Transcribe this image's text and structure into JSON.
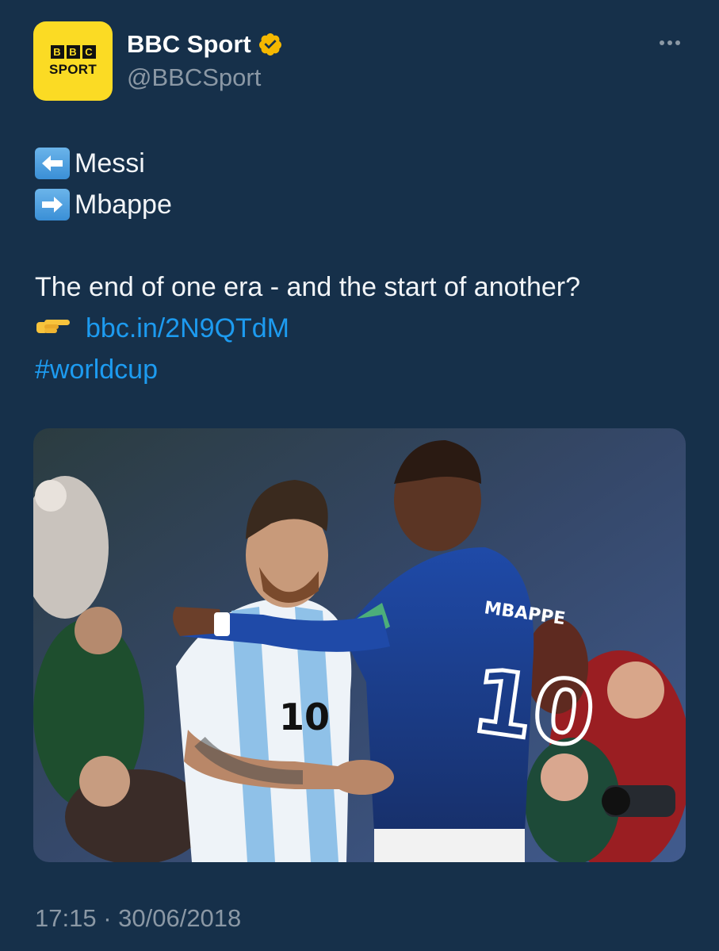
{
  "author": {
    "display_name": "BBC Sport",
    "handle": "@BBCSport",
    "avatar_letters": [
      "B",
      "B",
      "C"
    ],
    "avatar_word": "SPORT",
    "verified": true
  },
  "tweet": {
    "line1_text": "Messi",
    "line2_text": "Mbappe",
    "sentence": "The end of one era - and the start of another?",
    "link_text": "bbc.in/2N9QTdM",
    "hashtag": "#worldcup",
    "timestamp": "17:15 · 30/06/2018"
  },
  "photo": {
    "description_icons": [
      "left-arrow-key-icon",
      "right-arrow-key-icon",
      "pointing-hand-icon"
    ],
    "jersey_left_name": "",
    "jersey_left_number": "10",
    "jersey_right_name": "MBAPPE",
    "jersey_right_number": "10"
  },
  "colors": {
    "background": "#16304a",
    "link": "#1d9bf0",
    "secondary_text": "#8b98a5",
    "avatar_bg": "#fbdb24",
    "verified_badge": "#f5b800"
  }
}
